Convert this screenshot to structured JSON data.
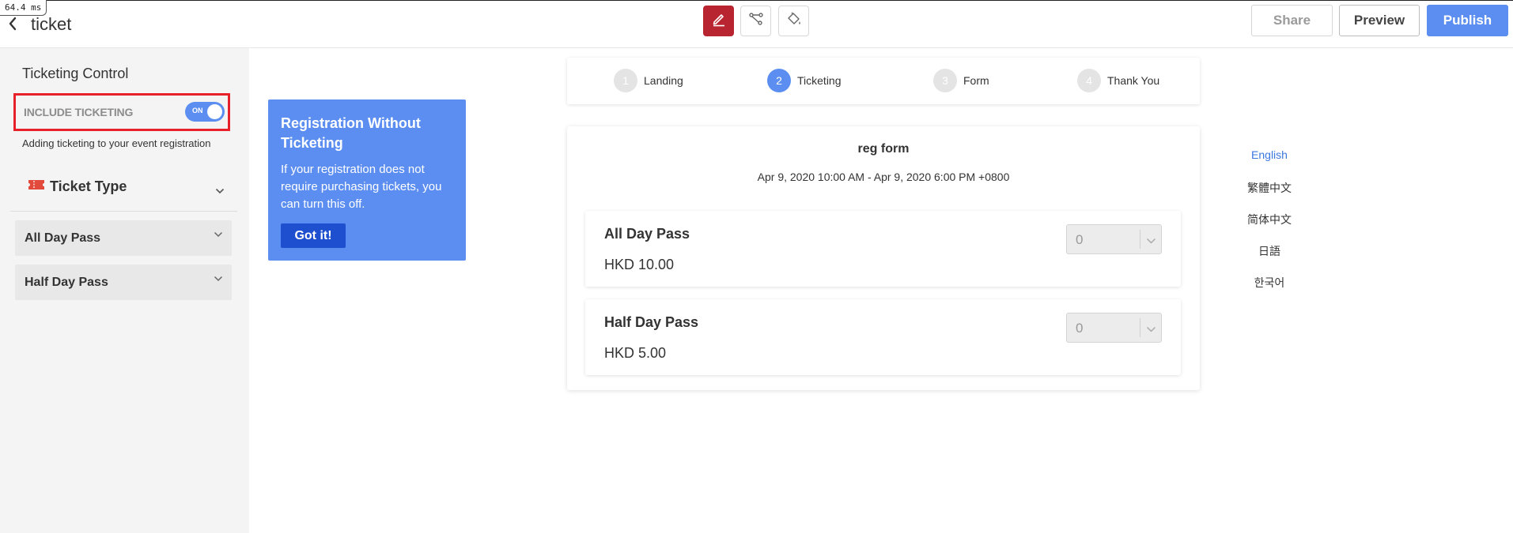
{
  "debug": {
    "timing": "64.4 ms"
  },
  "header": {
    "title": "ticket",
    "share_label": "Share",
    "preview_label": "Preview",
    "publish_label": "Publish"
  },
  "sidebar": {
    "title": "Ticketing Control",
    "include_label": "INCLUDE TICKETING",
    "toggle_text": "ON",
    "description": "Adding ticketing to your event registration",
    "ticket_type_label": "Ticket Type",
    "passes": [
      {
        "label": "All Day Pass"
      },
      {
        "label": "Half Day Pass"
      }
    ]
  },
  "tip": {
    "title": "Registration Without Ticketing",
    "body": "If your registration does not require purchasing tickets, you can turn this off.",
    "button": "Got it!"
  },
  "steps": [
    {
      "num": "1",
      "label": "Landing"
    },
    {
      "num": "2",
      "label": "Ticketing"
    },
    {
      "num": "3",
      "label": "Form"
    },
    {
      "num": "4",
      "label": "Thank You"
    }
  ],
  "form": {
    "title": "reg form",
    "date": "Apr 9, 2020 10:00 AM - Apr 9, 2020 6:00 PM +0800",
    "tickets": [
      {
        "name": "All Day Pass",
        "price": "HKD 10.00",
        "qty": "0"
      },
      {
        "name": "Half Day Pass",
        "price": "HKD 5.00",
        "qty": "0"
      }
    ]
  },
  "languages": [
    "English",
    "繁體中文",
    "简体中文",
    "日語",
    "한국어"
  ],
  "colors": {
    "accent": "#5b8ef0",
    "active_tool": "#b8242f",
    "highlight": "#e8202a",
    "link": "#3b78e0"
  }
}
